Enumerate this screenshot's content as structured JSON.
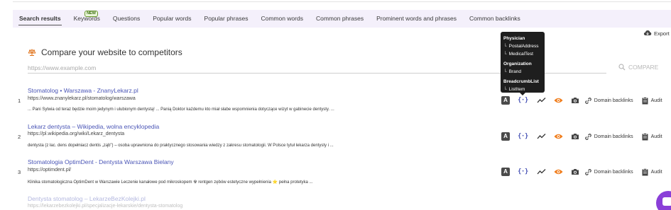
{
  "tabs": [
    {
      "label": "Search results",
      "active": true
    },
    {
      "label": "Keywords",
      "badge": "NEW"
    },
    {
      "label": "Questions"
    },
    {
      "label": "Popular words"
    },
    {
      "label": "Popular phrases"
    },
    {
      "label": "Common words"
    },
    {
      "label": "Common phrases"
    },
    {
      "label": "Prominent words and phrases"
    },
    {
      "label": "Common backlinks"
    }
  ],
  "export_label": "Export",
  "compare": {
    "title": "Compare your website to competitors",
    "placeholder": "https://www.example.com",
    "button": "COMPARE"
  },
  "results": [
    {
      "num": "1",
      "title": "Stomatolog • Warszawa - ZnanyLekarz.pl",
      "url": "https://www.znanylekarz.pl/stomatolog/warszawa",
      "snippet": "... Pani Sylwia od teraz będzie moim jedynym i ulubionym dentystą! ... Panią Doktor każdemu kto miał słabe wspomnienia dotyczące wizyt w gabinecie dentysty. ..."
    },
    {
      "num": "2",
      "title": "Lekarz dentysta – Wikipedia, wolna encyklopedia",
      "url": "https://pl.wikipedia.org/wiki/Lekarz_dentysta",
      "snippet": "dentysta (z łac. dens dopełniacz dentis „ząb\") – osoba uprawniona do praktycznego stosowania wiedzy z zakresu stomatologii. W Polsce tytuł lekarza dentysty i ..."
    },
    {
      "num": "3",
      "title": "Stomatologia OptimDent - Dentysta Warszawa Bielany",
      "url": "https://optimdent.pl/",
      "snippet": "Klinika stomatologiczna OptimDent w Warszawie Leczenie kanałowe pod mikroskopem ☢ rentgen zębów estetyczne wypełnienia ⭐ pełna protetyka ..."
    },
    {
      "num": "",
      "title": "Dentysta stomatolog – LekarzeBezKolejki.pl",
      "url": "https://lekarzebezkolejki.pl/specjalizacje-lekarskie/dentysta-stomatolog",
      "snippet": ""
    }
  ],
  "actions": {
    "badge_letter": "A",
    "schema_glyph": "{·}",
    "domain_backlinks": "Domain backlinks",
    "audit": "Audit"
  },
  "tooltip": {
    "groups": [
      {
        "type": "Physician",
        "children": [
          "PostalAddress",
          "MedicalTest"
        ]
      },
      {
        "type": "Organization",
        "children": [
          "Brand"
        ]
      },
      {
        "type": "BreadcrumbList",
        "children": [
          "ListItem"
        ]
      }
    ],
    "tree_glyph": "└"
  },
  "colors": {
    "accent": "#4a55b6",
    "eye": "#f07c1a",
    "tabbar_bg": "#f4f0fb",
    "chat": "#8a3fd8"
  }
}
